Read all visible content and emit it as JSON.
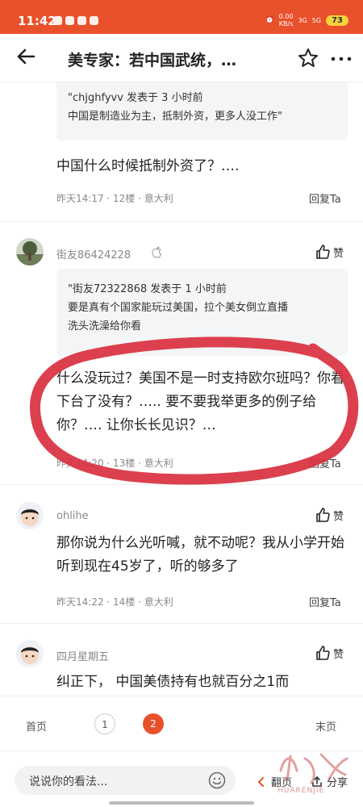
{
  "status_bar": {
    "time": "11:42",
    "net_speed": "0.00",
    "net_unit": "KB/s",
    "signal_1": "3G",
    "signal_2": "5G",
    "battery": "73"
  },
  "header": {
    "title": "美专家：若中国武统，…",
    "icons": [
      "back-arrow-icon",
      "star-icon",
      "more-icon"
    ]
  },
  "comments": [
    {
      "quote": {
        "line1": "\"chjghfyvv 发表于 3 小时前",
        "line2": "中国是制造业为主，抵制外资，更多人没工作\""
      },
      "text": "中国什么时候抵制外资了？….",
      "time": "昨天14:17",
      "floor": "12楼",
      "location": "意大利",
      "reply_label": "回复Ta"
    },
    {
      "username": "街友86424228",
      "like_label": "赞",
      "quote": {
        "line1": "\"街友72322868 发表于 1 小时前",
        "line2": "要是真有个国家能玩过美国，拉个美女倒立直播",
        "line3": "洗头洗澡给你看"
      },
      "text": "什么没玩过？美国不是一时支持欧尔班吗？你看下台了没有？….. 要不要我举更多的例子给你？…. 让你长长见识？…",
      "time": "昨天14:20",
      "floor": "13楼",
      "location": "意大利",
      "reply_label": "回复Ta"
    },
    {
      "username": "ohlihe",
      "like_label": "赞",
      "text": "那你说为什么光听喊，就不动呢？我从小学开始听到现在45岁了，听的够多了",
      "time": "昨天14:22",
      "floor": "14楼",
      "location": "意大利",
      "reply_label": "回复Ta"
    },
    {
      "username": "四月星期五",
      "like_label": "赞",
      "text": "纠正下， 中国美债持有也就百分之1而"
    }
  ],
  "pagination": {
    "first": "首页",
    "pages": [
      "1",
      "2"
    ],
    "current": "2",
    "last": "末页"
  },
  "bottom_bar": {
    "comment_placeholder": "说说你的看法...",
    "flip_label": "翻页",
    "share_label": "分享"
  },
  "watermark": {
    "brand": "HUARENJIE"
  },
  "colors": {
    "accent": "#e8512b",
    "annotation": "#d9303f",
    "quote_bg": "#f4f5f7"
  }
}
